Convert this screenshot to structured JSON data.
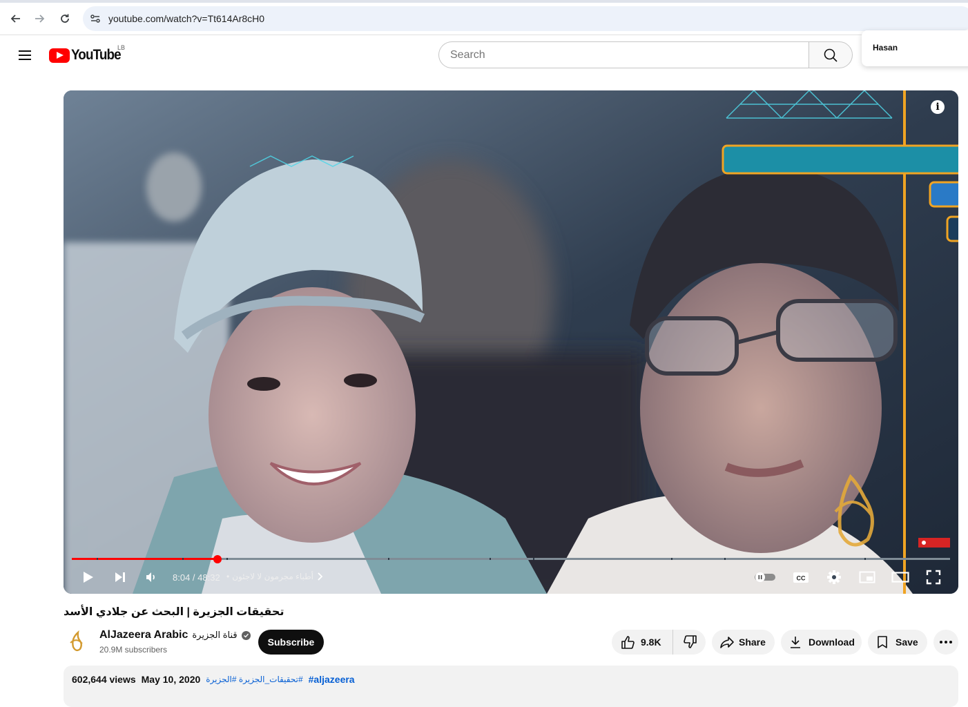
{
  "browser": {
    "url": "youtube.com/watch?v=Tt614Ar8cH0",
    "back_icon": "arrow-left-icon",
    "forward_icon": "arrow-right-icon",
    "reload_icon": "reload-icon"
  },
  "header": {
    "logo_text": "YouTube",
    "country_code": "LB",
    "search_placeholder": "Search",
    "account_name": "Hasan"
  },
  "player": {
    "time_current": "8:04",
    "time_total": "48:32",
    "time_separator": " / ",
    "chapter_title": "أطباء مجرمون لا لاجئون",
    "chapter_bullet": "•",
    "progress_fraction": 0.166,
    "colors": {
      "progress": "#ff0000",
      "track": "#7f8c96"
    }
  },
  "video": {
    "title": "تحقيقات الجزيرة | البحث عن جلادي الأسد",
    "channel_name": "AlJazeera Arabic",
    "channel_name_ar": "قناة الجزيرة",
    "subscribers": "20.9M subscribers",
    "subscribe_label": "Subscribe",
    "likes": "9.8K",
    "share_label": "Share",
    "download_label": "Download",
    "save_label": "Save"
  },
  "description": {
    "views": "602,644 views",
    "date": "May 10, 2020",
    "hashtags_ar": "#تحقيقات_الجزيرة #الجزيرة",
    "hashtag_en": "#aljazeera"
  }
}
